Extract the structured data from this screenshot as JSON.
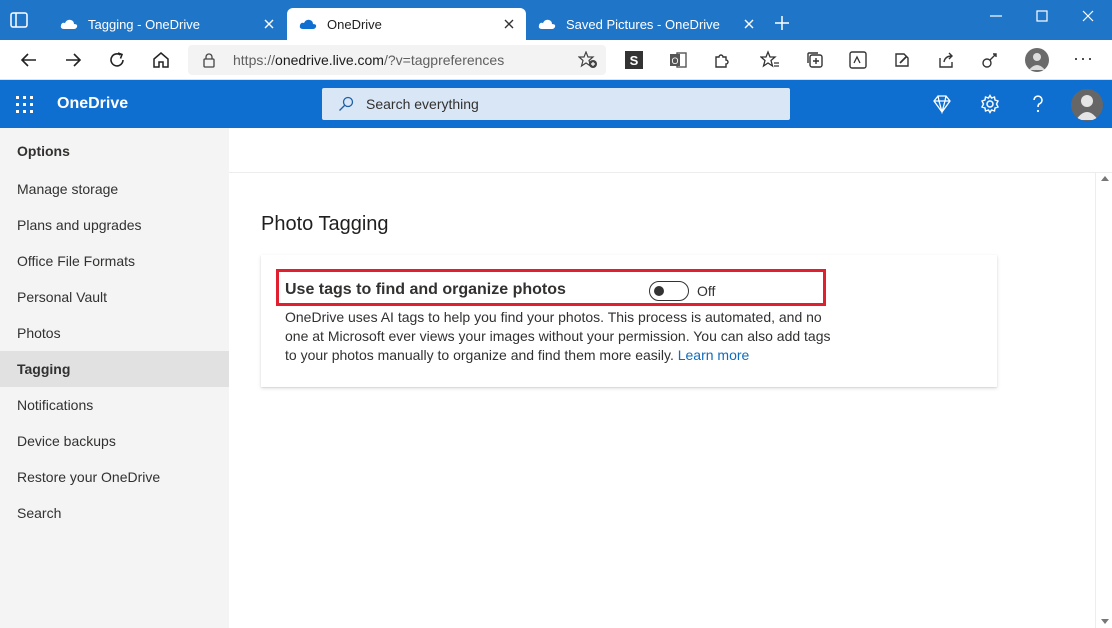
{
  "browser": {
    "tabs": [
      {
        "title": "Tagging - OneDrive",
        "active": false
      },
      {
        "title": "OneDrive",
        "active": true
      },
      {
        "title": "Saved Pictures - OneDrive",
        "active": false
      }
    ],
    "url": {
      "scheme": "https://",
      "host": "onedrive.live.com",
      "path": "/?v=tagpreferences"
    },
    "colors": {
      "titlebar": "#1f76c9"
    }
  },
  "app": {
    "brand": "OneDrive",
    "search_placeholder": "Search everything",
    "accent": "#0f6fd1",
    "header_icons": [
      "premium-diamond-icon",
      "settings-gear-icon",
      "help-icon"
    ]
  },
  "sidebar": {
    "heading": "Options",
    "items": [
      {
        "label": "Manage storage"
      },
      {
        "label": "Plans and upgrades"
      },
      {
        "label": "Office File Formats"
      },
      {
        "label": "Personal Vault"
      },
      {
        "label": "Photos"
      },
      {
        "label": "Tagging",
        "active": true
      },
      {
        "label": "Notifications"
      },
      {
        "label": "Device backups"
      },
      {
        "label": "Restore your OneDrive"
      },
      {
        "label": "Search"
      }
    ]
  },
  "main": {
    "title": "Photo Tagging",
    "setting": {
      "label": "Use tags to find and organize photos",
      "toggle_state": "Off",
      "description": "OneDrive uses AI tags to help you find your photos. This process is automated, and no one at Microsoft ever views your images without your permission. You can also add tags to your photos manually to organize and find them more easily.",
      "link": "Learn more"
    },
    "highlight_color": "#e0202f"
  }
}
